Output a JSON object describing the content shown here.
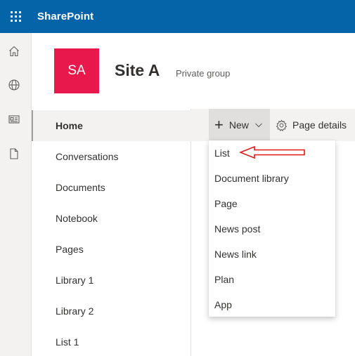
{
  "app": {
    "title": "SharePoint",
    "icons": {
      "waffle": "app-launcher-icon"
    }
  },
  "rail": {
    "items": [
      {
        "name": "home-icon"
      },
      {
        "name": "globe-icon"
      },
      {
        "name": "news-icon"
      },
      {
        "name": "document-icon"
      }
    ]
  },
  "site": {
    "logo_initials": "SA",
    "logo_color": "#e9184c",
    "title": "Site A",
    "subtitle": "Private group"
  },
  "nav": {
    "items": [
      {
        "label": "Home",
        "selected": true
      },
      {
        "label": "Conversations"
      },
      {
        "label": "Documents"
      },
      {
        "label": "Notebook"
      },
      {
        "label": "Pages"
      },
      {
        "label": "Library 1"
      },
      {
        "label": "Library 2"
      },
      {
        "label": "List 1"
      }
    ]
  },
  "commandbar": {
    "new_label": "New",
    "page_details_label": "Page details"
  },
  "new_menu": {
    "items": [
      {
        "label": "List"
      },
      {
        "label": "Document library"
      },
      {
        "label": "Page"
      },
      {
        "label": "News post"
      },
      {
        "label": "News link"
      },
      {
        "label": "Plan"
      },
      {
        "label": "App"
      }
    ]
  },
  "annotation": {
    "arrow_color": "#e3161b",
    "points_to": "List"
  },
  "colors": {
    "brand": "#0563a8",
    "rail_bg": "#f3f2f1"
  }
}
